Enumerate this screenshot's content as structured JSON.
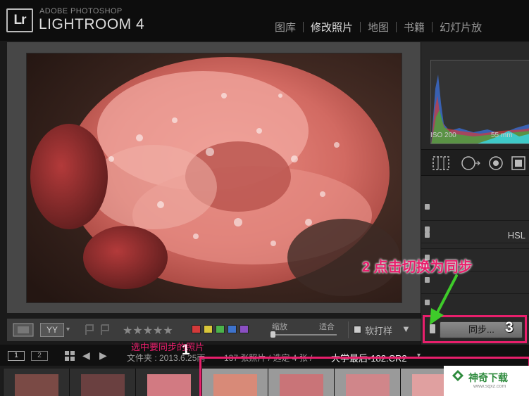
{
  "app": {
    "logo": "Lr",
    "brand_top": "ADOBE PHOTOSHOP",
    "brand_name": "LIGHTROOM 4"
  },
  "modules": [
    "图库",
    "修改照片",
    "地图",
    "书籍",
    "幻灯片放"
  ],
  "active_module": 1,
  "histogram": {
    "iso": "ISO 200",
    "focal": "55 mm"
  },
  "panels": [
    {
      "label": ""
    },
    {
      "label": ""
    },
    {
      "label": "HSL"
    },
    {
      "label": ""
    },
    {
      "label": ""
    },
    {
      "label": ""
    }
  ],
  "toolbar": {
    "view_mode": "YY",
    "zoom_label": "缩放",
    "fit_label": "适合",
    "soft_proof": "软打样",
    "color_labels": [
      "#d43a3a",
      "#d8c63a",
      "#4bb34b",
      "#3e73cc",
      "#8a4fc2"
    ]
  },
  "sync": {
    "button_label": "同步..."
  },
  "filmstrip": {
    "screen1": "1",
    "screen2": "2",
    "info": "文件夹 : 2013.6.25雨",
    "counts": "137 张照片 / 选定 4 张 /",
    "filename": "大学最后-182.CR2"
  },
  "annotations": {
    "num1": "1",
    "num3": "3",
    "step2": "2 点击切换为同步",
    "caption": "选中要同步的照片"
  },
  "watermark": {
    "text": "神奇下载",
    "sub": "www.sqxz.com"
  },
  "colors": {
    "highlight": "#e81f6c",
    "arrow": "#3ecb2a"
  }
}
